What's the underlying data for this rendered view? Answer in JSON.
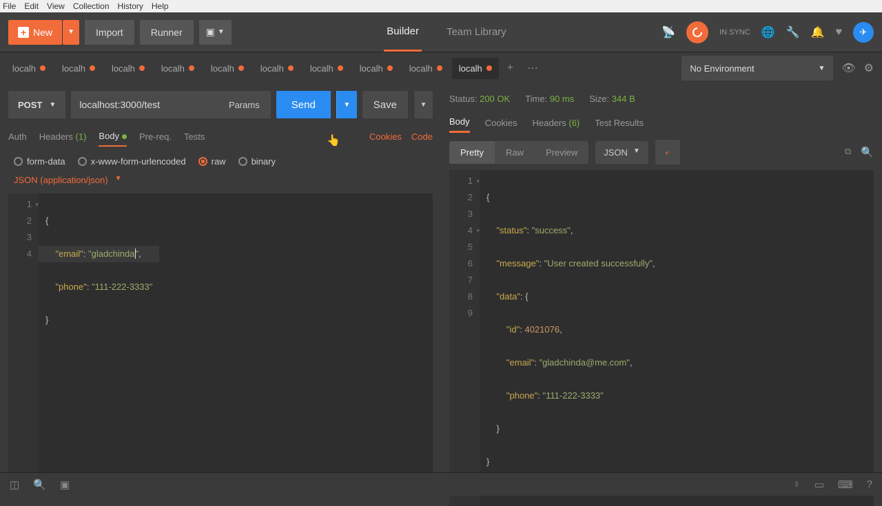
{
  "menu": {
    "file": "File",
    "edit": "Edit",
    "view": "View",
    "collection": "Collection",
    "history": "History",
    "help": "Help"
  },
  "toolbar": {
    "new": "New",
    "import": "Import",
    "runner": "Runner"
  },
  "topTabs": {
    "builder": "Builder",
    "team": "Team Library"
  },
  "sync": {
    "label": "IN SYNC"
  },
  "env": {
    "selected": "No Environment"
  },
  "reqTabs": {
    "items": [
      {
        "label": "localh"
      },
      {
        "label": "localh"
      },
      {
        "label": "localh"
      },
      {
        "label": "localh"
      },
      {
        "label": "localh"
      },
      {
        "label": "localh"
      },
      {
        "label": "localh"
      },
      {
        "label": "localh"
      },
      {
        "label": "localh"
      },
      {
        "label": "localh"
      }
    ]
  },
  "request": {
    "method": "POST",
    "url": "localhost:3000/test",
    "params": "Params",
    "send": "Send",
    "save": "Save"
  },
  "reqSubTabs": {
    "auth": "Auth",
    "headers": "Headers",
    "headersCount": "(1)",
    "body": "Body",
    "prereq": "Pre-req.",
    "tests": "Tests",
    "cookies": "Cookies",
    "code": "Code"
  },
  "bodyTypes": {
    "form": "form-data",
    "urlencoded": "x-www-form-urlencoded",
    "raw": "raw",
    "binary": "binary"
  },
  "contentType": "JSON (application/json)",
  "reqBody": {
    "l1": "{",
    "l2a": "    \"email\"",
    "l2b": ": ",
    "l2c": "\"gladchinda",
    "l2d": "\"",
    "l2e": ",",
    "l3a": "    \"phone\"",
    "l3b": ": ",
    "l3c": "\"111-222-3333\"",
    "l4": "}"
  },
  "status": {
    "statusLabel": "Status:",
    "statusValue": "200 OK",
    "timeLabel": "Time:",
    "timeValue": "90 ms",
    "sizeLabel": "Size:",
    "sizeValue": "344 B"
  },
  "respTabs": {
    "body": "Body",
    "cookies": "Cookies",
    "headers": "Headers",
    "headersCount": "(6)",
    "tests": "Test Results"
  },
  "respToolbar": {
    "pretty": "Pretty",
    "raw": "Raw",
    "preview": "Preview",
    "type": "JSON"
  },
  "respBody": {
    "l1": "{",
    "l2a": "    \"status\"",
    "l2b": ": ",
    "l2c": "\"success\"",
    "l2d": ",",
    "l3a": "    \"message\"",
    "l3b": ": ",
    "l3c": "\"User created successfully\"",
    "l3d": ",",
    "l4a": "    \"data\"",
    "l4b": ": {",
    "l5a": "        \"id\"",
    "l5b": ": ",
    "l5c": "4021076",
    "l5d": ",",
    "l6a": "        \"email\"",
    "l6b": ": ",
    "l6c": "\"gladchinda@me.com\"",
    "l6d": ",",
    "l7a": "        \"phone\"",
    "l7b": ": ",
    "l7c": "\"111-222-3333\"",
    "l8": "    }",
    "l9": "}"
  }
}
